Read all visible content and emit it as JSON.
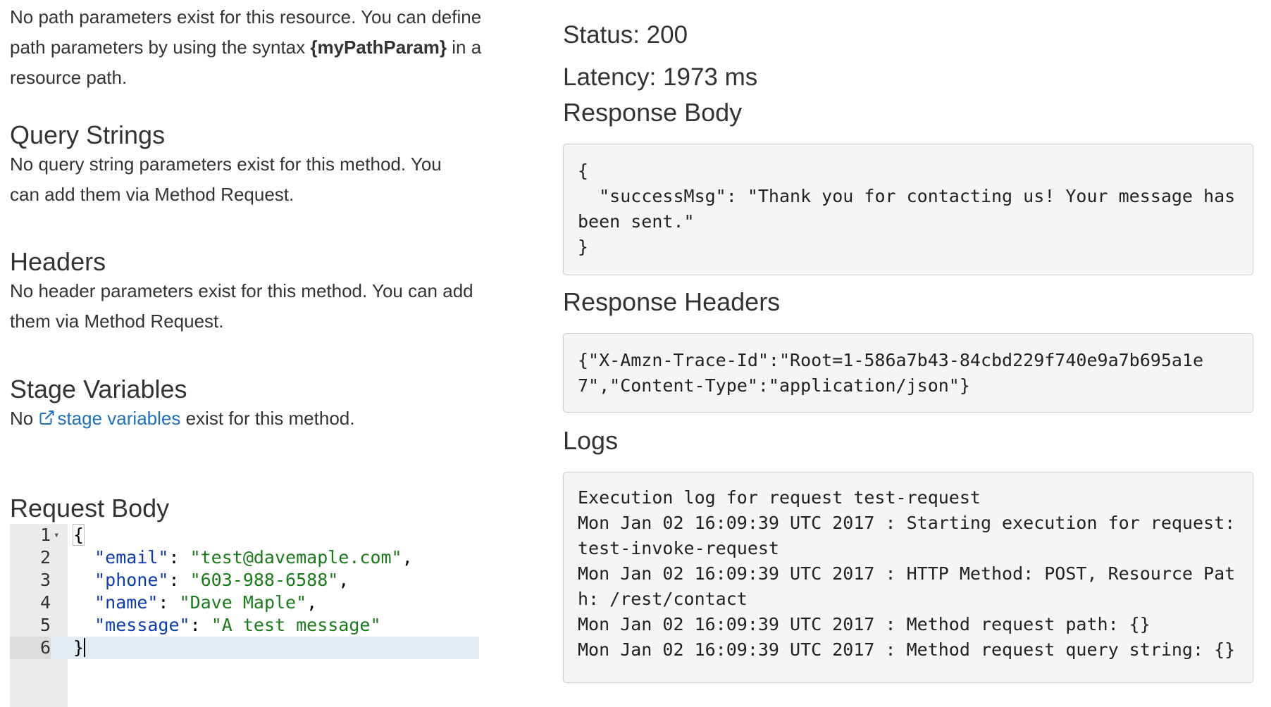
{
  "path_params": {
    "text_before": "No path parameters exist for this resource. You can define path parameters by using the syntax ",
    "syntax": "{myPathParam}",
    "text_after": " in a resource path."
  },
  "query_strings": {
    "title": "Query Strings",
    "text": "No query string parameters exist for this method. You can add them via Method Request."
  },
  "headers": {
    "title": "Headers",
    "text": "No header parameters exist for this method. You can add them via Method Request."
  },
  "stage_variables": {
    "title": "Stage Variables",
    "text_before": "No ",
    "link": "stage variables",
    "text_after": " exist for this method."
  },
  "request_body": {
    "title": "Request Body",
    "lines": [
      {
        "num": "1",
        "text": "{"
      },
      {
        "num": "2",
        "key": "\"email\"",
        "value": "\"test@davemaple.com\"",
        "end": ","
      },
      {
        "num": "3",
        "key": "\"phone\"",
        "value": "\"603-988-6588\"",
        "end": ","
      },
      {
        "num": "4",
        "key": "\"name\"",
        "value": "\"Dave Maple\"",
        "end": ","
      },
      {
        "num": "5",
        "key": "\"message\"",
        "value": "\"A test message\"",
        "end": ""
      },
      {
        "num": "6",
        "text": "}"
      }
    ]
  },
  "result": {
    "status": "Status: 200",
    "latency": "Latency: 1973 ms"
  },
  "response_body": {
    "title": "Response Body",
    "content": "{\n  \"successMsg\": \"Thank you for contacting us! Your message has been sent.\"\n}"
  },
  "response_headers": {
    "title": "Response Headers",
    "content": "{\"X-Amzn-Trace-Id\":\"Root=1-586a7b43-84cbd229f740e9a7b695a1e7\",\"Content-Type\":\"application/json\"}"
  },
  "logs": {
    "title": "Logs",
    "content": "Execution log for request test-request\nMon Jan 02 16:09:39 UTC 2017 : Starting execution for request: test-invoke-request\nMon Jan 02 16:09:39 UTC 2017 : HTTP Method: POST, Resource Path: /rest/contact\nMon Jan 02 16:09:39 UTC 2017 : Method request path: {}\nMon Jan 02 16:09:39 UTC 2017 : Method request query string: {}"
  }
}
